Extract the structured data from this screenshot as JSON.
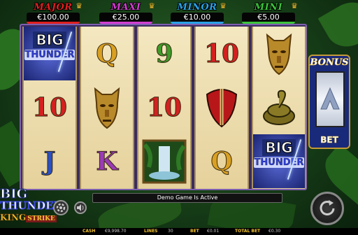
{
  "jackpots": [
    {
      "name": "MAJOR",
      "value": "€100.00",
      "color": "#e02020",
      "bar": "#e02020"
    },
    {
      "name": "MAXI",
      "value": "€25.00",
      "color": "#d23fd2",
      "bar": "#d23fd2"
    },
    {
      "name": "MINOR",
      "value": "€10.00",
      "color": "#2aa3e8",
      "bar": "#2aa3e8"
    },
    {
      "name": "MINI",
      "value": "€5.00",
      "color": "#3cc43c",
      "bar": "#3cc43c"
    }
  ],
  "reels": [
    [
      {
        "type": "big-thunder",
        "big": "BIG",
        "thunder": "THUNDER"
      },
      {
        "type": "letter",
        "text": "10",
        "color": "c-red"
      },
      {
        "type": "letter",
        "text": "J",
        "color": "c-blue"
      }
    ],
    [
      {
        "type": "letter",
        "text": "Q",
        "color": "c-gold"
      },
      {
        "type": "mask-icon"
      },
      {
        "type": "letter",
        "text": "K",
        "color": "c-purple"
      }
    ],
    [
      {
        "type": "letter",
        "text": "9",
        "color": "c-green"
      },
      {
        "type": "letter",
        "text": "10",
        "color": "c-red"
      },
      {
        "type": "waterfall-icon"
      }
    ],
    [
      {
        "type": "letter",
        "text": "10",
        "color": "c-red"
      },
      {
        "type": "shield-icon"
      },
      {
        "type": "letter",
        "text": "Q",
        "color": "c-gold"
      }
    ],
    [
      {
        "type": "mask-icon"
      },
      {
        "type": "snake-icon"
      },
      {
        "type": "big-thunder",
        "big": "BIG",
        "thunder": "THUNDER"
      }
    ]
  ],
  "bonus_panel": {
    "title": "BONUS",
    "bet_label": "BET"
  },
  "logo": {
    "line1": "BIG",
    "line2": "THUNDER",
    "line3": "KING",
    "line4": "STRIKE"
  },
  "message": "Demo Game Is Active",
  "icons": {
    "settings": "gear-icon",
    "sound": "speaker-icon",
    "spin": "spin-icon"
  },
  "status": {
    "cash_label": "CASH",
    "cash_value": "€9,998.70",
    "lines_label": "LINES",
    "lines_value": "30",
    "bet_label": "BET",
    "bet_value": "€0.01",
    "total_bet_label": "TOTAL BET",
    "total_bet_value": "€0.30"
  }
}
